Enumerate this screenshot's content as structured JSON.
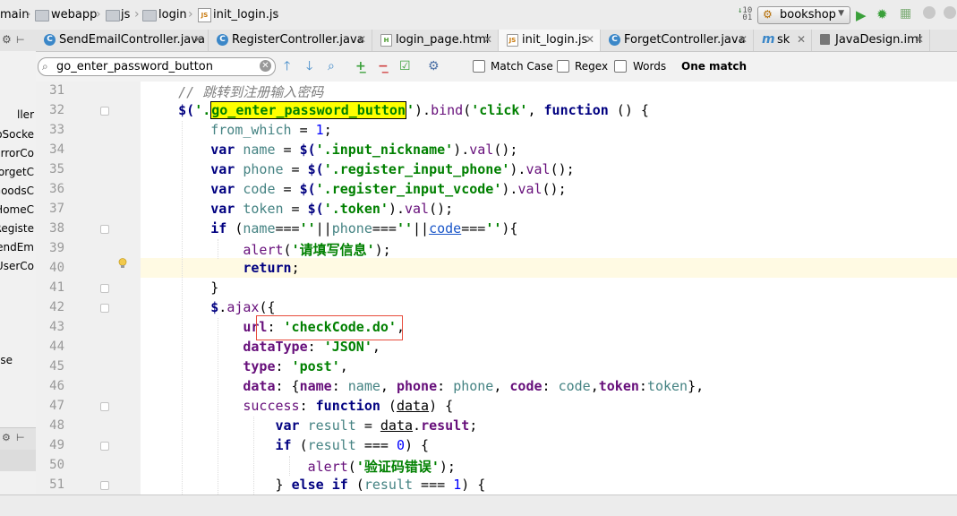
{
  "navbar": {
    "crumbs": [
      "main",
      "webapp",
      "js",
      "login",
      "init_login.js"
    ],
    "run_config": "bookshop"
  },
  "tabs": [
    {
      "label": "SendEmailController.java",
      "icon": "c"
    },
    {
      "label": "RegisterController.java",
      "icon": "c"
    },
    {
      "label": "login_page.html",
      "icon": "h"
    },
    {
      "label": "init_login.js",
      "icon": "js",
      "active": true
    },
    {
      "label": "ForgetController.java",
      "icon": "c"
    },
    {
      "label": "sk",
      "icon": "m"
    },
    {
      "label": "JavaDesign.iml",
      "icon": "iml"
    }
  ],
  "left_panel": {
    "items": [
      "ller",
      "oSocke",
      "ErrorCo",
      "orgetC",
      "GoodsC",
      "HomeC",
      "Registe",
      "SendEm",
      "UserCo",
      "se"
    ]
  },
  "search": {
    "query": "go_enter_password_button",
    "match_case": "Match Case",
    "regex": "Regex",
    "words": "Words",
    "result": "One match"
  },
  "editor": {
    "line_numbers": [
      "31",
      "32",
      "33",
      "34",
      "35",
      "36",
      "37",
      "38",
      "39",
      "40",
      "41",
      "42",
      "43",
      "44",
      "45",
      "46",
      "47",
      "48",
      "49",
      "50",
      "51"
    ],
    "code": {
      "comment_31": "// 跳转到注册输入密码",
      "selector_32": "go_enter_password_button",
      "event_32": "'click'",
      "from_which": "from_which",
      "one": "1",
      "sel_nickname": "'.input_nickname'",
      "sel_phone": "'.register_input_phone'",
      "sel_vcode": "'.register_input_vcode'",
      "sel_token": "'.token'",
      "msg_39": "'请填写信息'",
      "url_43": "'checkCode.do'",
      "datatype_44": "'JSON'",
      "type_45": "'post'",
      "msg_50": "'验证码错误'",
      "zero": "0"
    }
  }
}
